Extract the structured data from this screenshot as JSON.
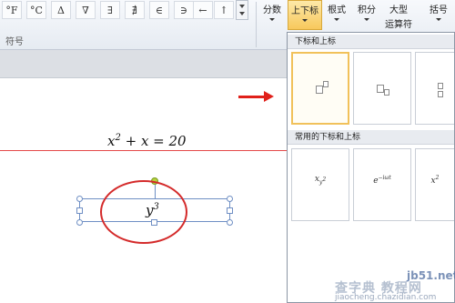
{
  "ribbon": {
    "symbols": [
      "°F",
      "°C",
      "Δ",
      "∇",
      "∃",
      "∄",
      "∈",
      "∋",
      "←",
      "↑"
    ],
    "group_label": "符号",
    "buttons": {
      "fraction": "分数",
      "script": "上下标",
      "radical": "根式",
      "integral": "积分",
      "large_operator_line1": "大型",
      "large_operator_line2": "运算符",
      "bracket": "括号"
    }
  },
  "document": {
    "equation": {
      "base": "x",
      "exp": "2",
      "rest": " + x = 20"
    },
    "selected_equation": {
      "base": "y",
      "exp": "3"
    }
  },
  "gallery": {
    "section1": "下标和上标",
    "section2": "常用的下标和上标",
    "common": [
      {
        "base": "x",
        "sub": "y",
        "sub_exp": "2"
      },
      {
        "base": "e",
        "sup": "−iωt"
      },
      {
        "base": "x",
        "sup": "2"
      }
    ]
  },
  "watermark": {
    "site": "jb51.net",
    "brand": "查字典 教程网",
    "url": "jiaocheng.chazidian.com"
  },
  "colors": {
    "annotation_red": "#e0201a",
    "active_button": "#f7c85c"
  }
}
